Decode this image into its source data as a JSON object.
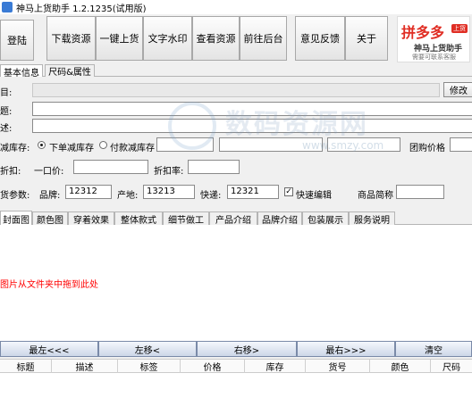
{
  "window": {
    "title": "神马上货助手 1.2.1235(试用版)"
  },
  "toolbar": {
    "login": "登陆",
    "buttons": [
      "下载资源",
      "一键上货",
      "文字水印",
      "查看资源",
      "前往后台",
      "意见反馈",
      "关于"
    ]
  },
  "banner": {
    "logo": "拼多多",
    "badge": "上货",
    "name": "神马上货助手",
    "sub": "需要可联系客服"
  },
  "tabs": [
    "基本信息",
    "尺码&属性"
  ],
  "form": {
    "category_label": "目:",
    "title_label": "题:",
    "desc_label": "述:",
    "edit_button": "修改",
    "stock_label": "减库存:",
    "stock_options": [
      "下单减库存",
      "付款减库存"
    ],
    "stock_selected": 0,
    "group_price_label": "团购价格",
    "discount_label": "折扣:",
    "fixed_price_label": "一口价:",
    "discount_rate_label": "折扣率:",
    "params_label": "货参数:",
    "brand_label": "品牌:",
    "brand_value": "12312",
    "origin_label": "产地:",
    "origin_value": "13213",
    "express_label": "快递:",
    "express_value": "12321",
    "quick_edit_label": "快速编辑",
    "quick_edit_checked": true,
    "short_name_label": "商品简称"
  },
  "image_tabs": [
    "封面图",
    "颜色图",
    "穿着效果",
    "整体款式",
    "细节做工",
    "产品介绍",
    "品牌介绍",
    "包装展示",
    "服务说明"
  ],
  "image_area": {
    "hint": "图片从文件夹中拖到此处"
  },
  "nav": [
    "最左<<<",
    "左移<",
    "右移>",
    "最右>>>",
    "清空"
  ],
  "table": {
    "columns": [
      "标题",
      "描述",
      "标签",
      "价格",
      "库存",
      "货号",
      "颜色",
      "尺码"
    ]
  },
  "watermark": {
    "text": "数码资源网",
    "url": "www.smzy.com"
  },
  "colors": {
    "hint_red": "#ff0000",
    "pdd_red": "#e02e24"
  }
}
